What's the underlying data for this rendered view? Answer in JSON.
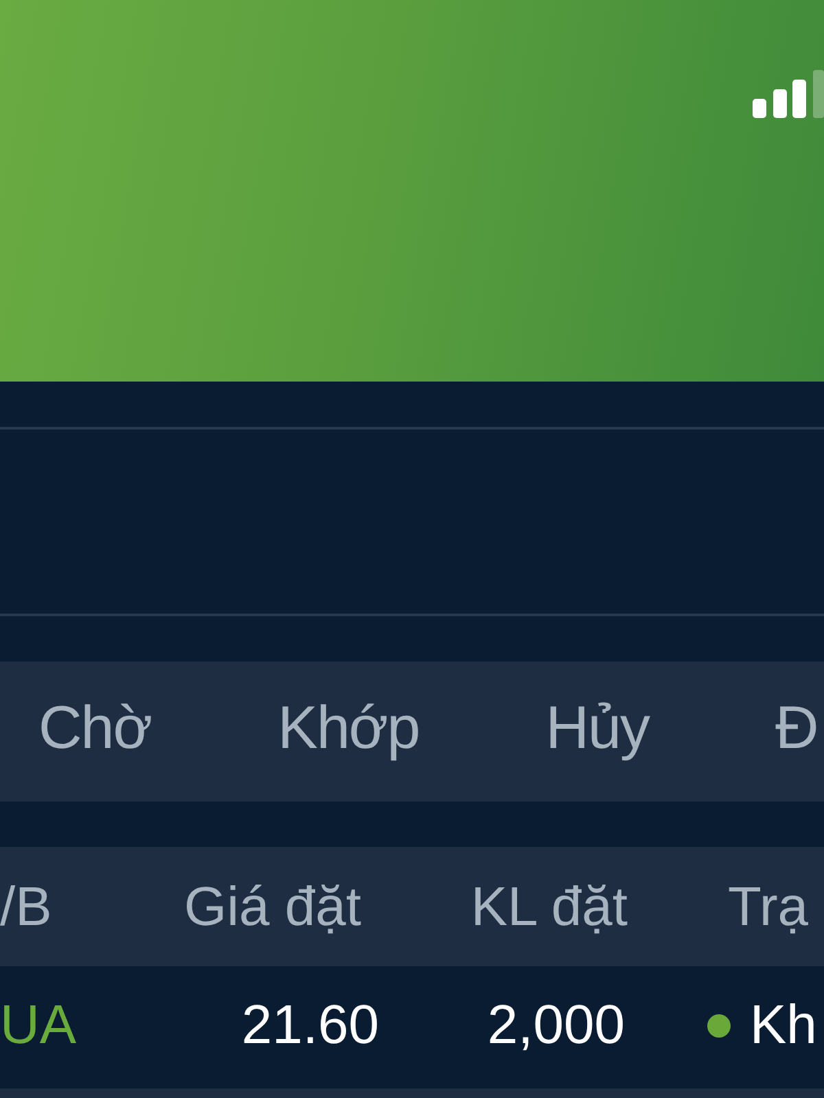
{
  "tabs": [
    {
      "label": "Chờ",
      "selected": false
    },
    {
      "label": "Khớp",
      "selected": false
    },
    {
      "label": "Hủy",
      "selected": false
    },
    {
      "label": "Đ",
      "selected": false
    }
  ],
  "table": {
    "columns": [
      "/B",
      "Giá đặt",
      "KL đặt",
      "Trạ"
    ],
    "rows": [
      {
        "kind": "buy",
        "side": "UA",
        "price": "21.60",
        "volume": "2,000",
        "status": "Kh",
        "color": "#6aa83a"
      }
    ]
  }
}
